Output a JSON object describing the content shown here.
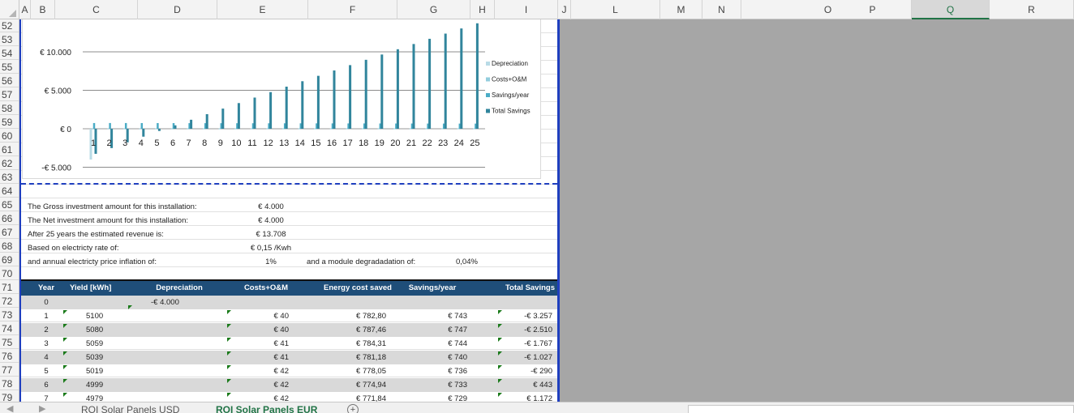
{
  "columns": [
    "A",
    "B",
    "C",
    "D",
    "E",
    "F",
    "G",
    "H",
    "I",
    "J",
    "L",
    "M",
    "N",
    "O",
    "P",
    "Q",
    "R"
  ],
  "selected_column": "Q",
  "rows": [
    "52",
    "53",
    "54",
    "55",
    "56",
    "57",
    "58",
    "59",
    "60",
    "61",
    "62",
    "63",
    "64",
    "65",
    "66",
    "67",
    "68",
    "69",
    "70",
    "71",
    "72",
    "73",
    "74",
    "75",
    "76",
    "77",
    "78",
    "79"
  ],
  "colors": {
    "accent": "#217346",
    "header_blue": "#1f4e79",
    "border_blue": "#1f3fbf",
    "bar_dark": "#31859c",
    "bar_light": "#93cddd"
  },
  "chart_data": {
    "type": "bar",
    "categories": [
      "1",
      "2",
      "3",
      "4",
      "5",
      "6",
      "7",
      "8",
      "9",
      "10",
      "11",
      "12",
      "13",
      "14",
      "15",
      "16",
      "17",
      "18",
      "19",
      "20",
      "21",
      "22",
      "23",
      "24",
      "25"
    ],
    "y_tick_labels": [
      "€ 10.000",
      "€ 5.000",
      "€ 0",
      "-€ 5.000"
    ],
    "ylim": [
      -5000,
      12500
    ],
    "legend": [
      "Depreciation",
      "Costs+O&M",
      "Savings/year",
      "Total Savings"
    ],
    "legend_position": "right",
    "series": [
      {
        "name": "Depreciation",
        "values": [
          -4000,
          0,
          0,
          0,
          0,
          0,
          0,
          0,
          0,
          0,
          0,
          0,
          0,
          0,
          0,
          0,
          0,
          0,
          0,
          0,
          0,
          0,
          0,
          0,
          0
        ]
      },
      {
        "name": "Costs+O&M",
        "values": [
          40,
          40,
          41,
          41,
          42,
          42,
          42,
          43,
          43,
          44,
          44,
          45,
          45,
          46,
          46,
          47,
          47,
          48,
          48,
          49,
          49,
          50,
          50,
          51,
          51
        ]
      },
      {
        "name": "Savings/year",
        "values": [
          743,
          747,
          744,
          740,
          736,
          733,
          729,
          726,
          722,
          719,
          715,
          712,
          708,
          705,
          701,
          698,
          694,
          691,
          688,
          684,
          681,
          678,
          674,
          671,
          668
        ]
      },
      {
        "name": "Total Savings",
        "values": [
          -3257,
          -2510,
          -1767,
          -1027,
          -290,
          443,
          1172,
          1898,
          2620,
          3339,
          4054,
          4766,
          5474,
          6179,
          6880,
          7578,
          8272,
          8963,
          9651,
          10335,
          11016,
          11694,
          12368,
          13039,
          13708
        ]
      }
    ]
  },
  "summary": [
    {
      "label": "The Gross investment amount for this installation:",
      "value": "€ 4.000"
    },
    {
      "label": "The Net investment amount for this installation:",
      "value": "€ 4.000"
    },
    {
      "label": "After 25 years the estimated revenue is:",
      "value": "€ 13.708"
    },
    {
      "label": "Based on electricty rate of:",
      "value": "€ 0,15 /Kwh"
    },
    {
      "label": "and annual electricty price inflation of:",
      "value": "1%"
    }
  ],
  "degradation": {
    "label": "and a module degradadation of:",
    "value": "0,04%"
  },
  "table": {
    "headers": [
      "Year",
      "Yield [kWh]",
      "Depreciation",
      "Costs+O&M",
      "Energy cost saved",
      "Savings/year",
      "Total Savings"
    ],
    "rows": [
      [
        "0",
        "",
        "-€ 4.000",
        "",
        "",
        "",
        ""
      ],
      [
        "1",
        "5100",
        "",
        "€ 40",
        "€ 782,80",
        "€ 743",
        "-€ 3.257"
      ],
      [
        "2",
        "5080",
        "",
        "€ 40",
        "€ 787,46",
        "€ 747",
        "-€ 2.510"
      ],
      [
        "3",
        "5059",
        "",
        "€ 41",
        "€ 784,31",
        "€ 744",
        "-€ 1.767"
      ],
      [
        "4",
        "5039",
        "",
        "€ 41",
        "€ 781,18",
        "€ 740",
        "-€ 1.027"
      ],
      [
        "5",
        "5019",
        "",
        "€ 42",
        "€ 778,05",
        "€ 736",
        "-€ 290"
      ],
      [
        "6",
        "4999",
        "",
        "€ 42",
        "€ 774,94",
        "€ 733",
        "€ 443"
      ],
      [
        "7",
        "4979",
        "",
        "€ 42",
        "€ 771,84",
        "€ 729",
        "€ 1.172"
      ]
    ]
  },
  "tabs": [
    "ROI Solar Panels USD",
    "ROI Solar Panels EUR"
  ],
  "active_tab": "ROI Solar Panels EUR",
  "add_sheet_symbol": "+"
}
